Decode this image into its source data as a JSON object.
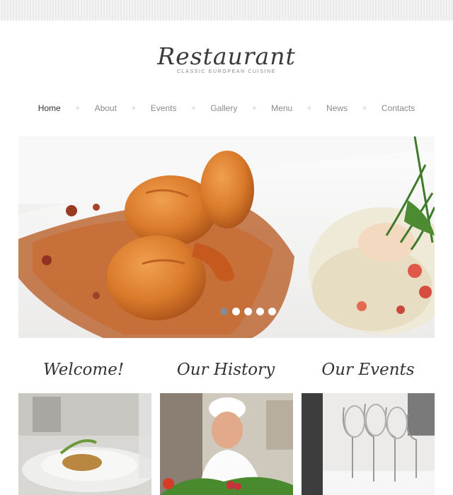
{
  "logo": {
    "title": "Restaurant",
    "tagline": "CLASSIC EUROPEAN CUISINE"
  },
  "nav": {
    "items": [
      {
        "label": "Home",
        "active": true
      },
      {
        "label": "About",
        "active": false
      },
      {
        "label": "Events",
        "active": false
      },
      {
        "label": "Gallery",
        "active": false
      },
      {
        "label": "Menu",
        "active": false
      },
      {
        "label": "News",
        "active": false
      },
      {
        "label": "Contacts",
        "active": false
      }
    ],
    "separator": "×"
  },
  "slider": {
    "dots": 5,
    "active_index": 0
  },
  "sections": [
    {
      "title": "Welcome!"
    },
    {
      "title": "Our History"
    },
    {
      "title": "Our Events"
    }
  ],
  "colors": {
    "nav_active": "#333333",
    "nav_inactive": "#8b8b8b"
  }
}
